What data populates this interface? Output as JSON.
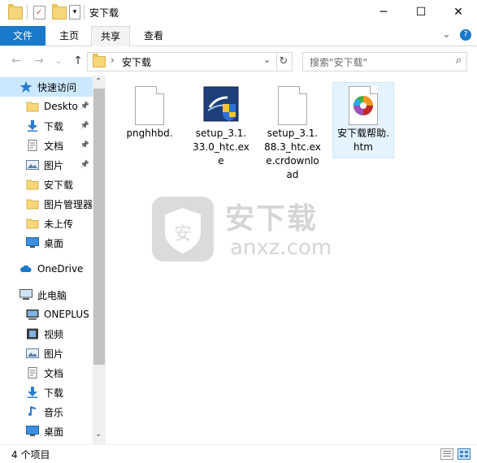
{
  "window": {
    "title": "安下载"
  },
  "quick_access_bar": {
    "dropdown_icon": "chevron-down-icon"
  },
  "window_controls": {
    "minimize": "─",
    "maximize": "☐",
    "close": "✕"
  },
  "ribbon": {
    "tabs": [
      {
        "label": "文件"
      },
      {
        "label": "主页"
      },
      {
        "label": "共享"
      },
      {
        "label": "查看"
      }
    ],
    "collapse_glyph": "⌄",
    "help_glyph": "?"
  },
  "navigation": {
    "back": "←",
    "forward": "→",
    "recent": "⌄",
    "up": "↑",
    "address_path": "安下载",
    "address_chevron": "›",
    "search_placeholder": "搜索\"安下载\"",
    "refresh": "↻"
  },
  "sidebar": {
    "items": [
      {
        "label": "快速访问",
        "icon": "star-icon",
        "selected": true,
        "pinned": false,
        "indent": 0
      },
      {
        "label": "Deskto",
        "icon": "folder-icon",
        "pinned": true,
        "indent": 1
      },
      {
        "label": "下载",
        "icon": "download-icon",
        "pinned": true,
        "indent": 1
      },
      {
        "label": "文档",
        "icon": "document-icon",
        "pinned": true,
        "indent": 1
      },
      {
        "label": "图片",
        "icon": "picture-icon",
        "pinned": true,
        "indent": 1
      },
      {
        "label": "安下载",
        "icon": "folder-icon",
        "pinned": false,
        "indent": 1
      },
      {
        "label": "图片管理器",
        "icon": "folder-icon",
        "pinned": false,
        "indent": 1
      },
      {
        "label": "未上传",
        "icon": "folder-icon",
        "pinned": false,
        "indent": 1
      },
      {
        "label": "桌面",
        "icon": "desktop-icon",
        "pinned": false,
        "indent": 1
      },
      {
        "label": "OneDrive",
        "icon": "cloud-icon",
        "pinned": false,
        "indent": 0
      },
      {
        "label": "此电脑",
        "icon": "computer-icon",
        "pinned": false,
        "indent": 0
      },
      {
        "label": "ONEPLUS",
        "icon": "phone-icon",
        "pinned": false,
        "indent": 1
      },
      {
        "label": "视频",
        "icon": "video-icon",
        "pinned": false,
        "indent": 1
      },
      {
        "label": "图片",
        "icon": "picture-icon",
        "pinned": false,
        "indent": 1
      },
      {
        "label": "文档",
        "icon": "document-icon",
        "pinned": false,
        "indent": 1
      },
      {
        "label": "下载",
        "icon": "download-icon",
        "pinned": false,
        "indent": 1
      },
      {
        "label": "音乐",
        "icon": "music-icon",
        "pinned": false,
        "indent": 1
      },
      {
        "label": "桌面",
        "icon": "desktop-icon",
        "pinned": false,
        "indent": 1
      }
    ],
    "scroll_up": "⌃",
    "scroll_down": "⌄"
  },
  "files": [
    {
      "name": "pnghhbd.",
      "icon": "blank-file-icon",
      "selected": false
    },
    {
      "name": "setup_3.1.33.0_htc.exe",
      "icon": "installer-icon",
      "selected": false
    },
    {
      "name": "setup_3.1.88.3_htc.exe.crdownload",
      "icon": "blank-file-icon",
      "selected": false
    },
    {
      "name": "安下载帮助.htm",
      "icon": "colorful-browser-icon",
      "selected": true
    }
  ],
  "watermark": {
    "brand": "安下载",
    "domain": "anxz.com",
    "shield_char": "安"
  },
  "status": {
    "item_count": "4 个项目"
  },
  "colors": {
    "accent": "#1979ca",
    "selection": "#cce8ff"
  }
}
